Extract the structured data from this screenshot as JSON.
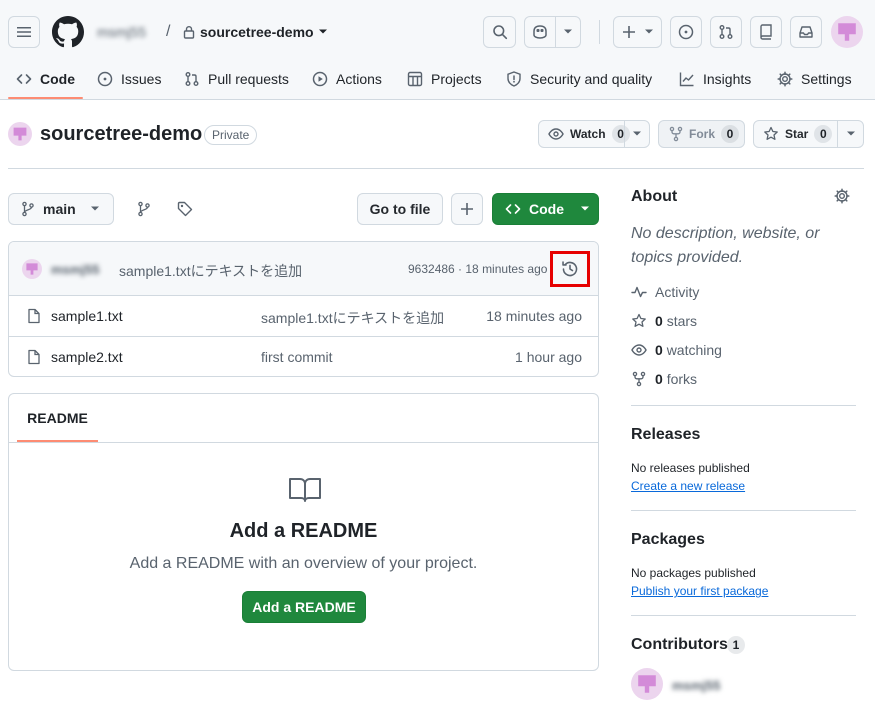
{
  "header": {
    "owner": "msmj55",
    "separator": "/",
    "repo_name": "sourcetree-demo"
  },
  "nav_tabs": [
    {
      "label": "Code",
      "icon": "code-icon",
      "selected": true
    },
    {
      "label": "Issues",
      "icon": "issue-icon"
    },
    {
      "label": "Pull requests",
      "icon": "pull-request-icon"
    },
    {
      "label": "Actions",
      "icon": "play-icon"
    },
    {
      "label": "Projects",
      "icon": "table-icon"
    },
    {
      "label": "Security and quality",
      "icon": "shield-icon"
    },
    {
      "label": "Insights",
      "icon": "graph-icon"
    },
    {
      "label": "Settings",
      "icon": "gear-icon"
    }
  ],
  "repo": {
    "name": "sourcetree-demo",
    "visibility": "Private",
    "watch_label": "Watch",
    "watch_count": "0",
    "fork_label": "Fork",
    "fork_count": "0",
    "star_label": "Star",
    "star_count": "0"
  },
  "toolbar": {
    "branch": "main",
    "go_to_file": "Go to file",
    "code_label": "Code"
  },
  "latest_commit": {
    "author": "msmj55",
    "message": "sample1.txtにテキストを追加",
    "meta": "9632486 · 18 minutes ago"
  },
  "files": [
    {
      "name": "sample1.txt",
      "message": "sample1.txtにテキストを追加",
      "time": "18 minutes ago"
    },
    {
      "name": "sample2.txt",
      "message": "first commit",
      "time": "1 hour ago"
    }
  ],
  "readme": {
    "tab": "README",
    "title": "Add a README",
    "description": "Add a README with an overview of your project.",
    "button": "Add a README"
  },
  "about": {
    "title": "About",
    "description": "No description, website, or topics provided.",
    "activity": "Activity",
    "stars_count": "0",
    "stars_label": "stars",
    "watching_count": "0",
    "watching_label": "watching",
    "forks_count": "0",
    "forks_label": "forks"
  },
  "releases": {
    "title": "Releases",
    "empty": "No releases published",
    "link": "Create a new release"
  },
  "packages": {
    "title": "Packages",
    "empty": "No packages published",
    "link": "Publish your first package"
  },
  "contributors": {
    "title": "Contributors",
    "count": "1",
    "name": "msmj55"
  },
  "colors": {
    "accent_green": "#1f883d",
    "tab_underline": "#fd8c73",
    "highlight": "#e60000",
    "avatar": "#d38bd8"
  }
}
